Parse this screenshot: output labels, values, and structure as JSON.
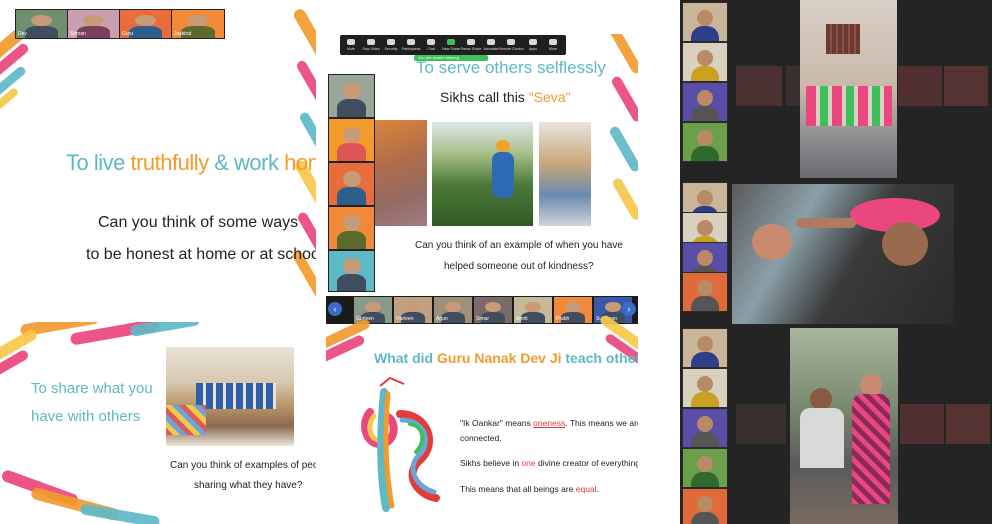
{
  "slide1": {
    "title_part1": "To live ",
    "title_hl1": "truthfully",
    "title_part2": " & work ",
    "title_hl2": "honestly",
    "question_line1": "Can you think of some ways",
    "question_line2": "to be honest at home or at school?",
    "participants": [
      "Dev",
      "Simran",
      "Guru",
      "Jaskirat"
    ]
  },
  "slide2": {
    "title": "To serve others selflessly",
    "subtitle_part1": "Sikhs call this ",
    "subtitle_hl": "\"Seva\"",
    "question_line1": "Can you think of an example of when you have",
    "question_line2": "helped someone out of kindness?",
    "banner": "You are screen sharing",
    "toolbar": [
      "Mute",
      "Stop Video",
      "Security",
      "Participants",
      "Chat",
      "New Share",
      "Pause Share",
      "Annotate",
      "Remote Control",
      "Apps",
      "More"
    ]
  },
  "slide3": {
    "title_line1": "To share what you",
    "title_line2": "have with others",
    "question_line1": "Can you think of examples of people",
    "question_line2": "sharing what they have?"
  },
  "slide4": {
    "title_part1": "What did ",
    "title_hl": "Guru Nanak Dev Ji",
    "title_part2": " teach others?",
    "line1_quote": "\"Ik Oankar\"",
    "line1_mid": " means ",
    "line1_hl": "oneness",
    "line1_end": ". This means we are all",
    "line1b": "connected.",
    "line2_start": "Sikhs believe in ",
    "line2_hl": "one",
    "line2_end": " divine creator of everything.",
    "line3_start": "This means that all beings are ",
    "line3_hl": "equal",
    "line3_end": ".",
    "participants": [
      "Gurleen",
      "Harleen",
      "Arjun",
      "Simar",
      "Amrit",
      "Prabh",
      "Sukhman",
      "Navjot"
    ]
  },
  "colors": {
    "teal": "#5fb8c6",
    "orange": "#f39a2d",
    "pink": "#e9477d",
    "red": "#e23b3b",
    "dark": "#2b2b2b"
  }
}
